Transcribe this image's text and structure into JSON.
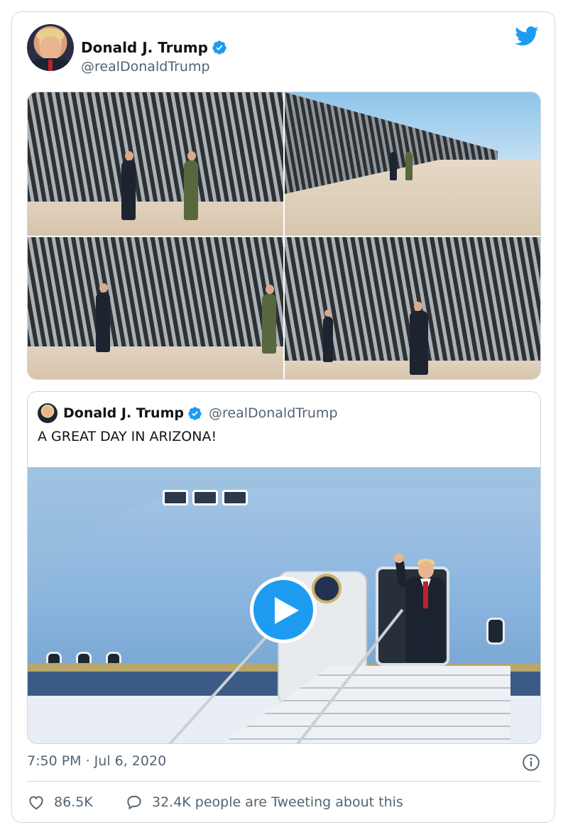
{
  "tweet": {
    "author_name": "Donald J. Trump",
    "handle": "@realDonaldTrump",
    "timestamp": "7:50 PM · Jul 6, 2020",
    "likes": "86.5K",
    "conversation": "32.4K people are Tweeting about this"
  },
  "quoted_tweet": {
    "author_name": "Donald J. Trump",
    "handle": "@realDonaldTrump",
    "text": "A GREAT DAY IN ARIZONA!"
  },
  "icons": {
    "logo": "twitter-bird-icon",
    "verified": "verified-badge-icon",
    "play": "play-icon",
    "info": "info-icon",
    "like": "heart-icon",
    "reply": "speech-bubble-icon"
  },
  "colors": {
    "accent": "#1d9bf0",
    "text_primary": "#0f1419",
    "text_secondary": "#536471",
    "border": "#cfd9de"
  }
}
